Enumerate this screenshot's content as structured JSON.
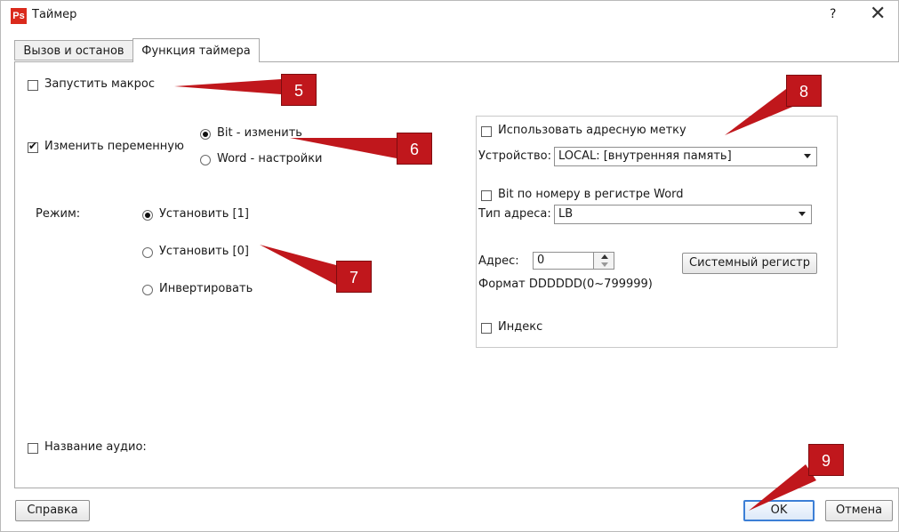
{
  "window": {
    "app_icon_text": "Ps",
    "title": "Таймер",
    "help_glyph": "?",
    "close_glyph": "✕"
  },
  "tabs": [
    {
      "label": "Вызов и останов",
      "active": false
    },
    {
      "label": "Функция таймера",
      "active": true
    }
  ],
  "form": {
    "run_macro": {
      "label": "Запустить макрос",
      "checked": false
    },
    "change_variable": {
      "label": "Изменить переменную",
      "checked": true
    },
    "variable_type": {
      "options": [
        {
          "label": "Bit - изменить",
          "selected": true
        },
        {
          "label": "Word - настройки",
          "selected": false
        }
      ]
    },
    "mode": {
      "label": "Режим:",
      "options": [
        {
          "label": "Установить [1]",
          "selected": true
        },
        {
          "label": "Установить [0]",
          "selected": false
        },
        {
          "label": "Инвертировать",
          "selected": false
        }
      ]
    },
    "audio_name": {
      "label": "Название аудио:",
      "checked": false
    }
  },
  "address": {
    "use_tag": {
      "label": "Использовать адресную метку",
      "checked": false
    },
    "device_label": "Устройство:",
    "device_value": "LOCAL: [внутренняя память]",
    "bit_by_word": {
      "label": "Bit по номеру в регистре Word",
      "checked": false
    },
    "addr_type_label": "Тип адреса:",
    "addr_type_value": "LB",
    "address_label": "Адрес:",
    "address_value": "0",
    "system_register_button": "Системный регистр",
    "format_text": "Формат DDDDDD(0~799999)",
    "index": {
      "label": "Индекс",
      "checked": false
    }
  },
  "footer": {
    "help_button": "Справка",
    "ok_button": "OK",
    "cancel_button": "Отмена"
  },
  "callouts": [
    "5",
    "6",
    "7",
    "8",
    "9"
  ],
  "colors": {
    "callout": "#c0171c",
    "app_icon": "#da2a1c",
    "ok_border": "#3c7fd6"
  }
}
